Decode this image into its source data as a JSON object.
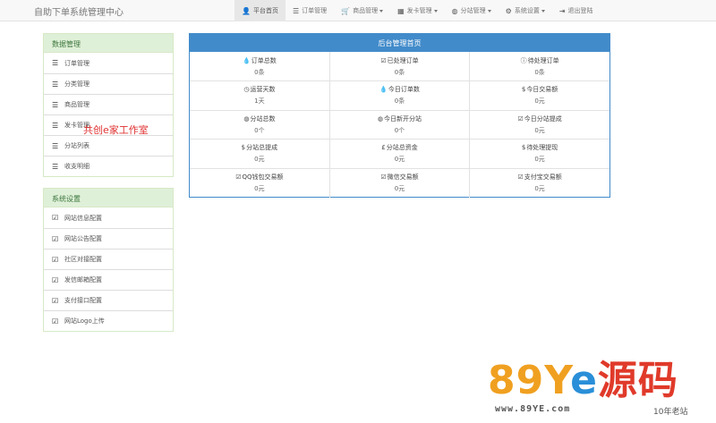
{
  "brand": "自助下单系统管理中心",
  "nav": [
    {
      "icon": "user-icon",
      "glyph": "👤",
      "label": "平台首页",
      "active": true,
      "dropdown": false
    },
    {
      "icon": "list-icon",
      "glyph": "☰",
      "label": "订单管理",
      "active": false,
      "dropdown": false
    },
    {
      "icon": "cart-icon",
      "glyph": "🛒",
      "label": "商品管理",
      "active": false,
      "dropdown": true
    },
    {
      "icon": "grid-icon",
      "glyph": "▦",
      "label": "发卡管理",
      "active": false,
      "dropdown": true
    },
    {
      "icon": "globe-icon",
      "glyph": "◍",
      "label": "分站管理",
      "active": false,
      "dropdown": true
    },
    {
      "icon": "gear-icon",
      "glyph": "⚙",
      "label": "系统设置",
      "active": false,
      "dropdown": true
    },
    {
      "icon": "logout-icon",
      "glyph": "⇥",
      "label": "退出登陆",
      "active": false,
      "dropdown": false
    }
  ],
  "data_panel": {
    "title": "数据管理",
    "items": [
      "订单管理",
      "分类管理",
      "商品管理",
      "发卡管理",
      "分站列表",
      "收支明细"
    ]
  },
  "settings_panel": {
    "title": "系统设置",
    "items": [
      "网站信息配置",
      "网站公告配置",
      "社区对接配置",
      "发信邮箱配置",
      "支付接口配置",
      "网站Logo上传"
    ]
  },
  "main": {
    "title": "后台管理首页",
    "rows": [
      [
        {
          "glyph": "💧",
          "icon": "drop-icon",
          "label": "订单总数",
          "value": "0条"
        },
        {
          "glyph": "☑",
          "icon": "check-icon",
          "label": "已处理订单",
          "value": "0条"
        },
        {
          "glyph": "ⓘ",
          "icon": "info-icon",
          "label": "待处理订单",
          "value": "0条"
        }
      ],
      [
        {
          "glyph": "◷",
          "icon": "clock-icon",
          "label": "运营天数",
          "value": "1天"
        },
        {
          "glyph": "💧",
          "icon": "drop-icon",
          "label": "今日订单数",
          "value": "0条"
        },
        {
          "glyph": "$",
          "icon": "dollar-icon",
          "label": "今日交易额",
          "value": "0元"
        }
      ],
      [
        {
          "glyph": "◍",
          "icon": "globe-icon",
          "label": "分站总数",
          "value": "0个"
        },
        {
          "glyph": "◍",
          "icon": "globe-icon",
          "label": "今日新开分站",
          "value": "0个"
        },
        {
          "glyph": "☑",
          "icon": "check-icon",
          "label": "今日分站提成",
          "value": "0元"
        }
      ],
      [
        {
          "glyph": "$",
          "icon": "dollar-icon",
          "label": "分站总提成",
          "value": "0元"
        },
        {
          "glyph": "£",
          "icon": "pound-icon",
          "label": "分站总资金",
          "value": "0元"
        },
        {
          "glyph": "$",
          "icon": "dollar-icon",
          "label": "待处理提现",
          "value": "0元"
        }
      ],
      [
        {
          "glyph": "☑",
          "icon": "check-icon",
          "label": "QQ钱包交易额",
          "value": "0元"
        },
        {
          "glyph": "☑",
          "icon": "check-icon",
          "label": "微信交易额",
          "value": "0元"
        },
        {
          "glyph": "☑",
          "icon": "check-icon",
          "label": "支付宝交易额",
          "value": "0元"
        }
      ]
    ]
  },
  "overlay_text": "共创e家工作室",
  "watermark": {
    "big1": "89Y",
    "big_e": "e",
    "big_cn": "源码",
    "url": "www.89YE.com",
    "tag": "10年老站"
  },
  "colors": {
    "panel_primary": "#428bca",
    "panel_success_bg": "#dff0d8",
    "panel_success_text": "#3c763d"
  }
}
